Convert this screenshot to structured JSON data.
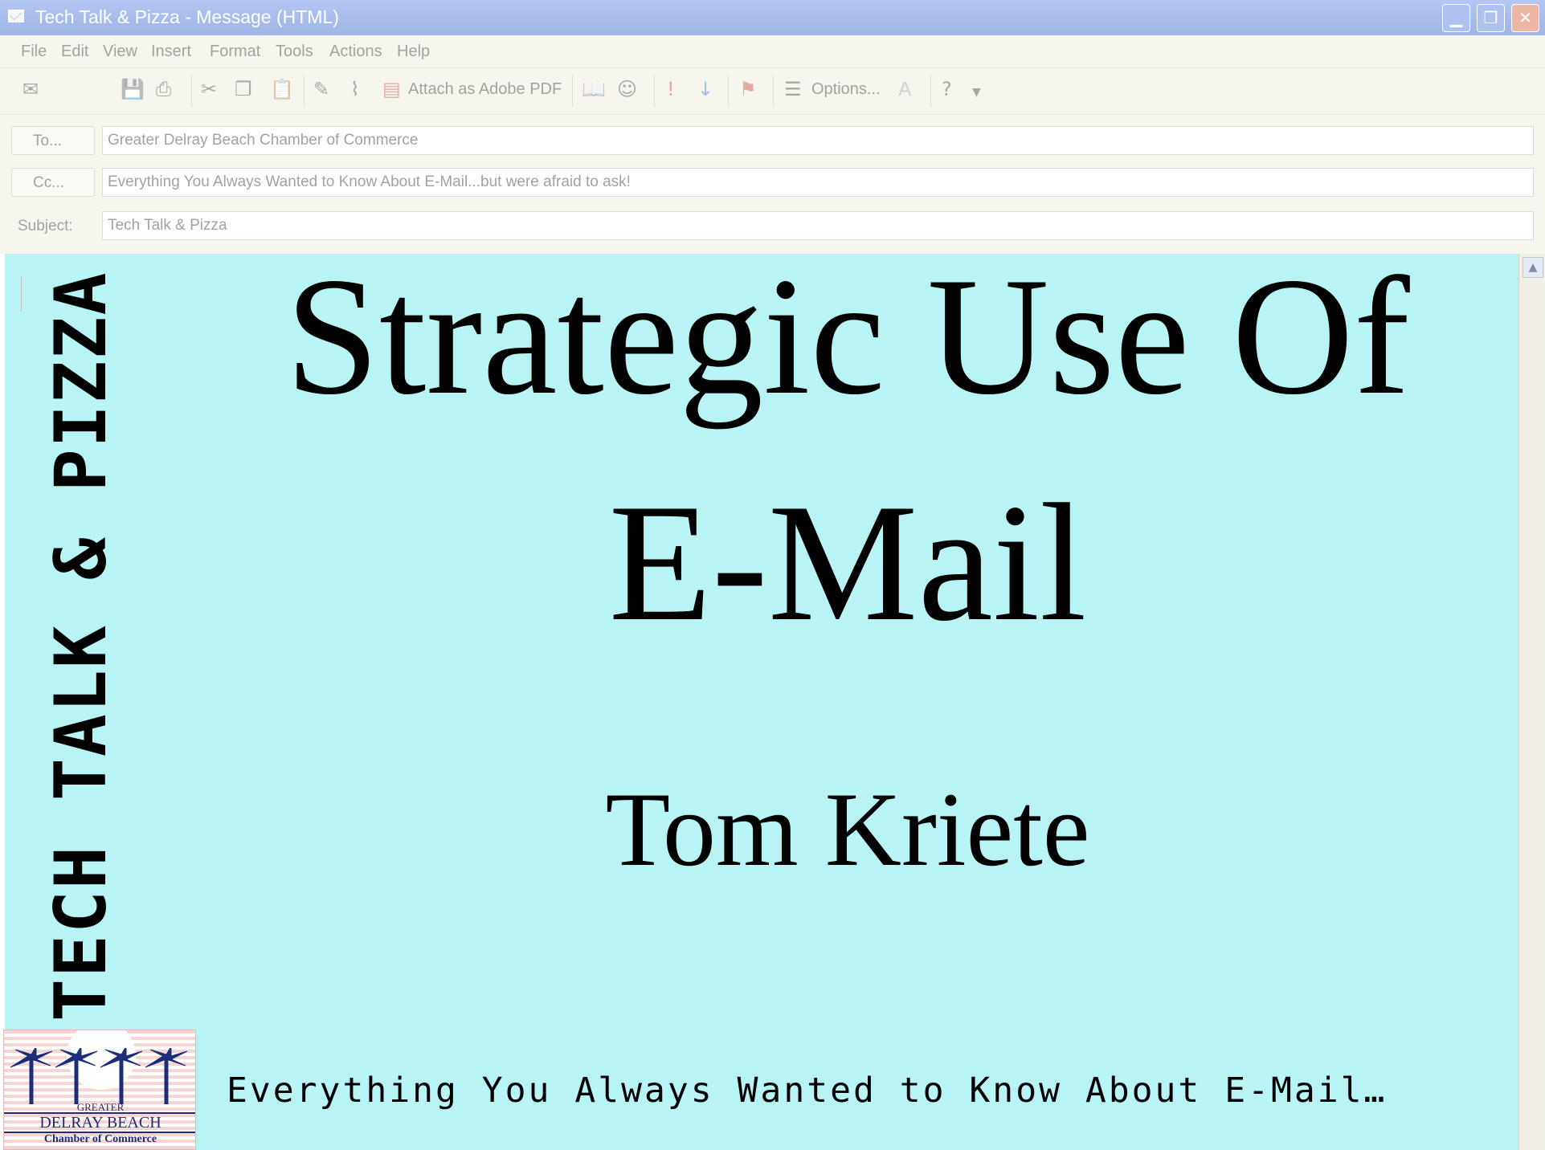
{
  "window": {
    "title": "Tech Talk & Pizza - Message (HTML)",
    "minimize": "▁",
    "restore": "❐",
    "close": "✕"
  },
  "menu": [
    "File",
    "Edit",
    "View",
    "Insert",
    "Format",
    "Tools",
    "Actions",
    "Help"
  ],
  "toolbar": {
    "attach_pdf": "Attach as Adobe PDF",
    "options": "Options..."
  },
  "header": {
    "to_label": "To...",
    "to_value": "Greater Delray Beach Chamber of Commerce",
    "cc_label": "Cc...",
    "cc_value": "Everything You Always Wanted to Know About E-Mail...but were afraid to ask!",
    "subject_label": "Subject:",
    "subject_value": "Tech Talk & Pizza"
  },
  "slide": {
    "title_line1": "Strategic Use Of",
    "title_line2": "E-Mail",
    "author": "Tom Kriete",
    "subtitle": "Everything You Always Wanted to Know About E-Mail…",
    "side_banner": "TECH TALK & PIZZA",
    "logo": {
      "line1": "GREATER",
      "line2": "DELRAY BEACH",
      "line3": "Chamber of Commerce"
    }
  },
  "colors": {
    "slide_background": "#b9f4f4",
    "titlebar": "#2f5fd0",
    "logo_text": "#1c2d7a"
  }
}
